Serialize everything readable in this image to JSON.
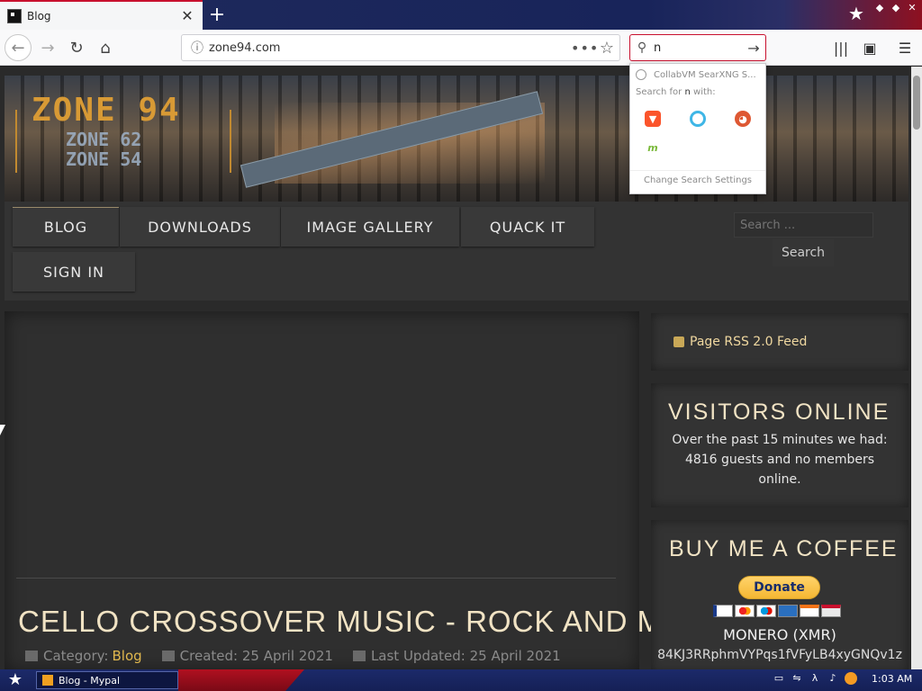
{
  "browser": {
    "tab": {
      "title": "Blog",
      "close_label": "✕"
    },
    "new_tab_label": "+",
    "url": "zone94.com",
    "url_more_label": "•••",
    "search_query": "n",
    "search_dropdown": {
      "first_result": "CollabVM SearXNG S...",
      "hint_prefix": "Search for",
      "hint_query": "n",
      "hint_suffix": "with:",
      "engines": [
        "brave",
        "qwant",
        "duckduckgo",
        "mojeek"
      ],
      "settings_label": "Change Search Settings"
    }
  },
  "site": {
    "logo_main": "ZONE 94",
    "logo_sub1": "ZONE 62",
    "logo_sub2": "ZONE 54",
    "nav": [
      "BLOG",
      "DOWNLOADS",
      "IMAGE GALLERY",
      "QUACK IT",
      "SIGN IN"
    ],
    "active_nav": "BLOG",
    "search_placeholder": "Search ...",
    "search_button": "Search"
  },
  "article": {
    "title": "CELLO CROSSOVER MUSIC - ROCK AND METAL",
    "category_label": "Category:",
    "category": "Blog",
    "created": "Created: 25 April 2021",
    "updated": "Last Updated: 25 April 2021"
  },
  "sidebar": {
    "rss_label": "Page RSS 2.0 Feed",
    "visitors_heading": "VISITORS ONLINE",
    "visitors_line1": "Over the past 15 minutes we had:",
    "visitors_line2": "4816 guests and no members",
    "visitors_line3": "online.",
    "coffee_heading": "BUY ME A COFFEE",
    "donate_label": "Donate",
    "coin_name": "MONERO (XMR)",
    "coin_address": "84KJ3RRphmVYPqs1fVFyLB4xyGNQv1z"
  },
  "taskbar": {
    "window_title": "Blog - Mypal",
    "clock": "1:03 AM"
  },
  "colors": {
    "accent_red": "#c8102e",
    "title_gold": "#f1e3c4",
    "link_gold": "#e1b84e",
    "donate_yellow": "#f5b733"
  }
}
